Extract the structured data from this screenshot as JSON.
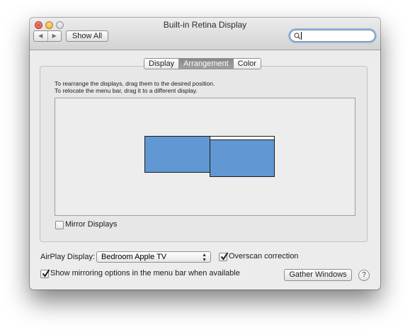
{
  "window": {
    "title": "Built-in Retina Display"
  },
  "toolbar": {
    "back_icon": "◀",
    "forward_icon": "▶",
    "show_all_label": "Show All",
    "search": {
      "value": "",
      "placeholder": ""
    }
  },
  "tabs": [
    {
      "label": "Display",
      "selected": false
    },
    {
      "label": "Arrangement",
      "selected": true
    },
    {
      "label": "Color",
      "selected": false
    }
  ],
  "arrangement": {
    "instruction_line1": "To rearrange the displays, drag them to the desired position.",
    "instruction_line2": "To relocate the menu bar, drag it to a different display.",
    "mirror_displays": {
      "label": "Mirror Displays",
      "checked": false
    }
  },
  "airplay": {
    "label": "AirPlay Display:",
    "selected_value": "Bedroom Apple TV",
    "overscan_correction": {
      "label": "Overscan correction",
      "checked": true
    }
  },
  "show_mirroring": {
    "label": "Show mirroring options in the menu bar when available",
    "checked": true
  },
  "gather_windows_label": "Gather Windows",
  "help_label": "?",
  "colors": {
    "display_fill": "#6198d3",
    "selected_tab": "#959595",
    "window_background": "#ececec"
  }
}
